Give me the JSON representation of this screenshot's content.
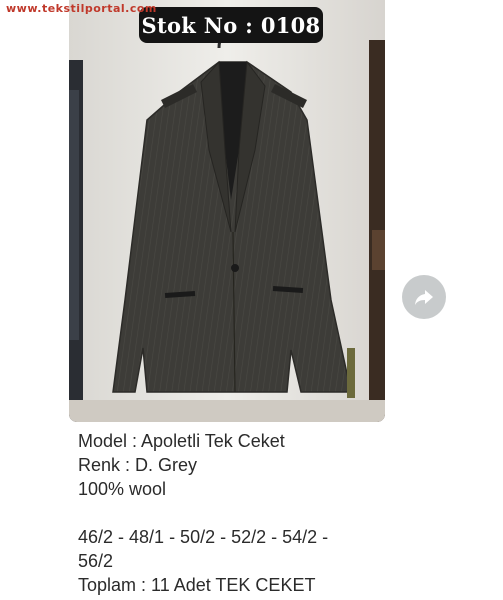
{
  "watermark": "www.tekstilportal.com",
  "message": {
    "stock_badge": "Stok No : 0108",
    "image_subject": "grey suit jacket on hanger",
    "caption": {
      "model": "Model : Apoletli Tek Ceket",
      "color": "Renk : D. Grey",
      "material": "100% wool",
      "sizes_line1": "46/2 - 48/1 - 50/2 - 52/2 - 54/2 -",
      "sizes_line2": "56/2",
      "total": "Toplam : 11 Adet TEK CEKET"
    }
  },
  "forward": {
    "icon": "forward-arrow-icon"
  },
  "colors": {
    "badge_bg": "#141414",
    "forward_bg": "#c8cbcc",
    "watermark": "#c0392b",
    "text": "#2b2b2b"
  }
}
